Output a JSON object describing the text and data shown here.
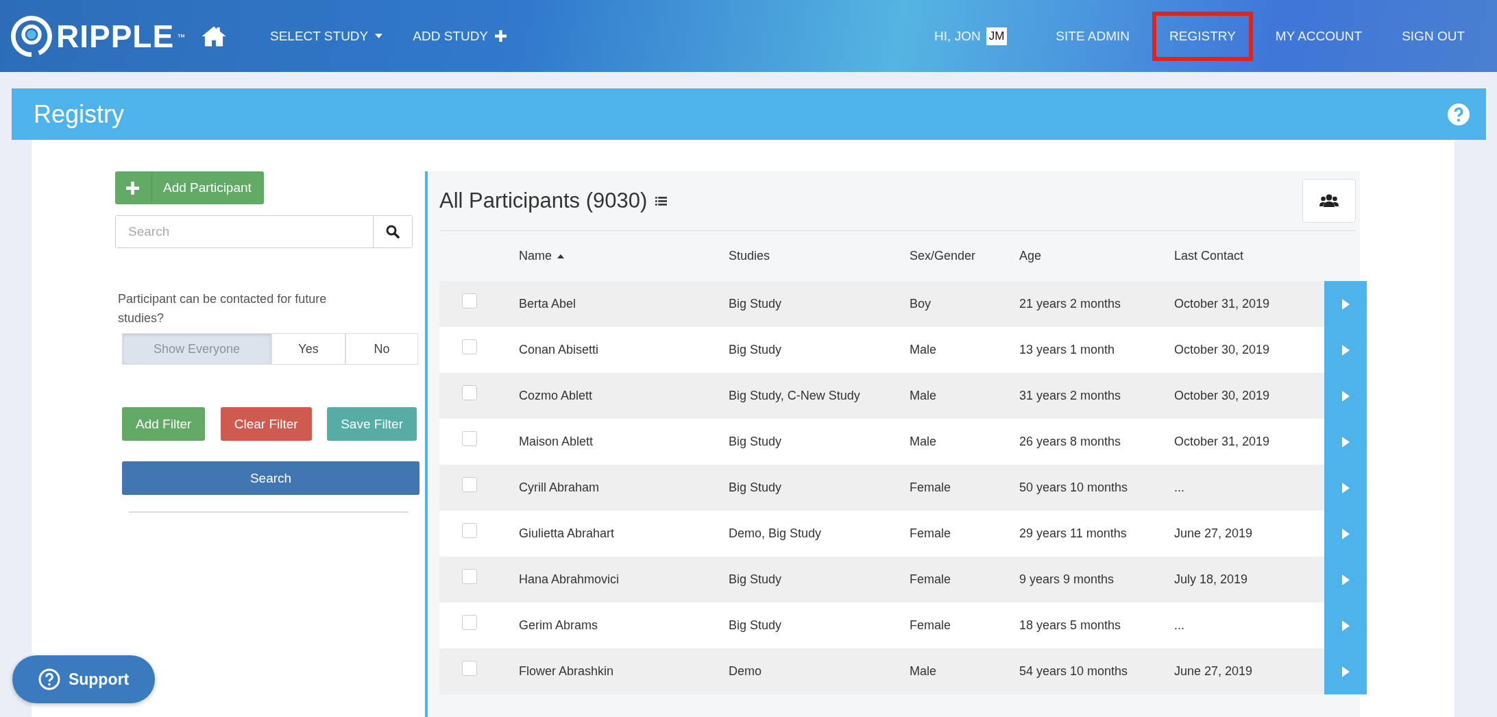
{
  "header": {
    "logo": "RIPPLE",
    "trademark": "™",
    "nav_left": [
      {
        "label": "SELECT STUDY",
        "kind": "dropdown"
      },
      {
        "label": "ADD STUDY",
        "kind": "add"
      }
    ],
    "greeting": "HI, JON",
    "avatar": "JM",
    "nav_right": [
      {
        "label": "SITE ADMIN",
        "highlighted": false
      },
      {
        "label": "REGISTRY",
        "highlighted": true
      },
      {
        "label": "MY ACCOUNT",
        "highlighted": false
      },
      {
        "label": "SIGN OUT",
        "highlighted": false
      }
    ]
  },
  "page_title": "Registry",
  "sidebar": {
    "add_button": "Add Participant",
    "search": {
      "placeholder": "Search"
    },
    "contact_question": "Participant can be contacted for future studies?",
    "contact_options": [
      {
        "label": "Show Everyone",
        "selected": true
      },
      {
        "label": "Yes",
        "selected": false
      },
      {
        "label": "No",
        "selected": false
      }
    ],
    "filter_buttons": [
      {
        "label": "Add Filter",
        "kind": "add"
      },
      {
        "label": "Clear Filter",
        "kind": "clear"
      },
      {
        "label": "Save Filter",
        "kind": "save"
      }
    ],
    "search_button": "Search"
  },
  "table": {
    "title": "All Participants (9030)",
    "columns": [
      {
        "label": "Name",
        "sorted": true
      },
      {
        "label": "Studies",
        "sorted": false
      },
      {
        "label": "Sex/Gender",
        "sorted": false
      },
      {
        "label": "Age",
        "sorted": false
      },
      {
        "label": "Last Contact",
        "sorted": false
      }
    ],
    "rows": [
      {
        "checked": false,
        "cells": [
          "Berta Abel",
          "Big Study",
          "Boy",
          "21 years 2 months",
          "October 31, 2019"
        ]
      },
      {
        "checked": false,
        "cells": [
          "Conan Abisetti",
          "Big Study",
          "Male",
          "13 years 1 month",
          "October 30, 2019"
        ]
      },
      {
        "checked": false,
        "cells": [
          "Cozmo Ablett",
          "Big Study, C-New Study",
          "Male",
          "31 years 2 months",
          "October 30, 2019"
        ]
      },
      {
        "checked": false,
        "cells": [
          "Maison Ablett",
          "Big Study",
          "Male",
          "26 years 8 months",
          "October 31, 2019"
        ]
      },
      {
        "checked": false,
        "cells": [
          "Cyrill Abraham",
          "Big Study",
          "Female",
          "50 years 10 months",
          "..."
        ]
      },
      {
        "checked": false,
        "cells": [
          "Giulietta Abrahart",
          "Demo, Big Study",
          "Female",
          "29 years 11 months",
          "June 27, 2019"
        ]
      },
      {
        "checked": false,
        "cells": [
          "Hana Abrahmovici",
          "Big Study",
          "Female",
          "9 years 9 months",
          "July 18, 2019"
        ]
      },
      {
        "checked": false,
        "cells": [
          "Gerim Abrams",
          "Big Study",
          "Female",
          "18 years 5 months",
          "..."
        ]
      },
      {
        "checked": false,
        "cells": [
          "Flower Abrashkin",
          "Demo",
          "Male",
          "54 years 10 months",
          "June 27, 2019"
        ]
      }
    ]
  },
  "support_button": "Support"
}
